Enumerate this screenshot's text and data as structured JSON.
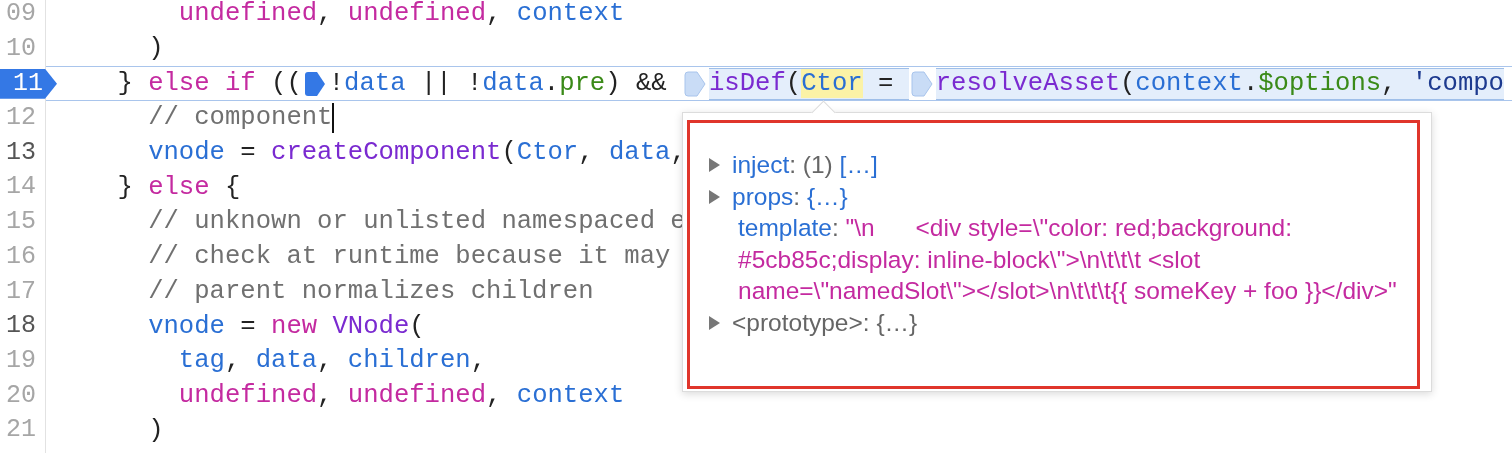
{
  "editor": {
    "lines": [
      {
        "number": "09",
        "emphasized": false,
        "paused": false,
        "segments": [
          {
            "kind": "code",
            "highlighted": false,
            "tokens": [
              {
                "t": "        undefined",
                "kind": "kw"
              },
              {
                "t": ", "
              },
              {
                "t": "undefined",
                "kind": "kw"
              },
              {
                "t": ", "
              },
              {
                "t": "context",
                "kind": "var"
              }
            ]
          }
        ]
      },
      {
        "number": "10",
        "emphasized": false,
        "paused": false,
        "segments": [
          {
            "kind": "code",
            "highlighted": false,
            "tokens": [
              {
                "t": "      )"
              }
            ]
          }
        ]
      },
      {
        "number": "11",
        "emphasized": false,
        "paused": true,
        "segments": [
          {
            "kind": "code",
            "highlighted": false,
            "tokens": [
              {
                "t": "    } "
              },
              {
                "t": "else if",
                "kind": "kw"
              },
              {
                "t": " (("
              }
            ]
          },
          {
            "kind": "marker",
            "active": true
          },
          {
            "kind": "code",
            "highlighted": false,
            "tokens": [
              {
                "t": "!"
              },
              {
                "t": "data",
                "kind": "var"
              },
              {
                "t": " || !"
              },
              {
                "t": "data",
                "kind": "var"
              },
              {
                "t": "."
              },
              {
                "t": "pre",
                "kind": "prop"
              },
              {
                "t": ") && "
              }
            ]
          },
          {
            "kind": "marker",
            "active": false
          },
          {
            "kind": "code",
            "highlighted": true,
            "tokens": [
              {
                "t": "isDef",
                "kind": "fn"
              },
              {
                "t": "("
              },
              {
                "t": "Ctor",
                "kind": "var",
                "match": true
              },
              {
                "t": " = "
              }
            ]
          },
          {
            "kind": "marker",
            "active": false
          },
          {
            "kind": "code",
            "highlighted": true,
            "tokens": [
              {
                "t": "resolveAsset",
                "kind": "fn"
              },
              {
                "t": "("
              },
              {
                "t": "context",
                "kind": "var"
              },
              {
                "t": "."
              },
              {
                "t": "$options",
                "kind": "prop"
              },
              {
                "t": ", "
              },
              {
                "t": "'compo",
                "kind": "str"
              }
            ]
          }
        ]
      },
      {
        "number": "12",
        "emphasized": false,
        "paused": false,
        "segments": [
          {
            "kind": "code",
            "highlighted": false,
            "tokens": [
              {
                "t": "      // component",
                "kind": "cmt"
              }
            ]
          },
          {
            "kind": "caret"
          }
        ]
      },
      {
        "number": "13",
        "emphasized": true,
        "paused": false,
        "segments": [
          {
            "kind": "code",
            "highlighted": false,
            "tokens": [
              {
                "t": "      vnode",
                "kind": "var"
              },
              {
                "t": " = "
              },
              {
                "t": "createComponent",
                "kind": "fn"
              },
              {
                "t": "("
              },
              {
                "t": "Ctor",
                "kind": "var"
              },
              {
                "t": ", "
              },
              {
                "t": "data",
                "kind": "var"
              },
              {
                "t": ","
              }
            ]
          }
        ]
      },
      {
        "number": "14",
        "emphasized": false,
        "paused": false,
        "segments": [
          {
            "kind": "code",
            "highlighted": false,
            "tokens": [
              {
                "t": "    } "
              },
              {
                "t": "else",
                "kind": "kw"
              },
              {
                "t": " {"
              }
            ]
          }
        ]
      },
      {
        "number": "15",
        "emphasized": false,
        "paused": false,
        "segments": [
          {
            "kind": "code",
            "highlighted": false,
            "tokens": [
              {
                "t": "      // unknown or unlisted namespaced e",
                "kind": "cmt"
              }
            ]
          }
        ]
      },
      {
        "number": "16",
        "emphasized": false,
        "paused": false,
        "segments": [
          {
            "kind": "code",
            "highlighted": false,
            "tokens": [
              {
                "t": "      // check at runtime because it may",
                "kind": "cmt"
              }
            ]
          }
        ]
      },
      {
        "number": "17",
        "emphasized": false,
        "paused": false,
        "segments": [
          {
            "kind": "code",
            "highlighted": false,
            "tokens": [
              {
                "t": "      // parent normalizes children",
                "kind": "cmt"
              }
            ]
          }
        ]
      },
      {
        "number": "18",
        "emphasized": true,
        "paused": false,
        "segments": [
          {
            "kind": "code",
            "highlighted": false,
            "tokens": [
              {
                "t": "      vnode",
                "kind": "var"
              },
              {
                "t": " = "
              },
              {
                "t": "new ",
                "kind": "kw"
              },
              {
                "t": "VNode",
                "kind": "fn"
              },
              {
                "t": "("
              }
            ]
          }
        ]
      },
      {
        "number": "19",
        "emphasized": false,
        "paused": false,
        "segments": [
          {
            "kind": "code",
            "highlighted": false,
            "tokens": [
              {
                "t": "        tag",
                "kind": "var"
              },
              {
                "t": ", "
              },
              {
                "t": "data",
                "kind": "var"
              },
              {
                "t": ", "
              },
              {
                "t": "children",
                "kind": "var"
              },
              {
                "t": ","
              }
            ]
          }
        ]
      },
      {
        "number": "20",
        "emphasized": false,
        "paused": false,
        "segments": [
          {
            "kind": "code",
            "highlighted": false,
            "tokens": [
              {
                "t": "        undefined",
                "kind": "kw"
              },
              {
                "t": ", "
              },
              {
                "t": "undefined",
                "kind": "kw"
              },
              {
                "t": ", "
              },
              {
                "t": "context",
                "kind": "var"
              }
            ]
          }
        ]
      },
      {
        "number": "21",
        "emphasized": false,
        "paused": false,
        "segments": [
          {
            "kind": "code",
            "highlighted": false,
            "tokens": [
              {
                "t": "      )"
              }
            ]
          }
        ]
      }
    ]
  },
  "popup": {
    "entries": [
      {
        "kind": "object",
        "expandable": true,
        "key": "inject",
        "colon": ":",
        "count": "(1)",
        "preview": "[…]"
      },
      {
        "kind": "object",
        "expandable": true,
        "key": "props",
        "colon": ":",
        "preview": "{…}"
      },
      {
        "kind": "string",
        "expandable": false,
        "key": "template",
        "colon": ":",
        "value": "\"\\n      <div style=\\\"color: red;background: #5cb85c;display: inline-block\\\">\\n\\t\\t\\t <slot name=\\\"namedSlot\\\"></slot>\\n\\t\\t\\t{{ someKey + foo }}</div>\""
      },
      {
        "kind": "proto",
        "expandable": true,
        "key": "<prototype>",
        "colon": ":",
        "preview": "{…}"
      }
    ]
  }
}
